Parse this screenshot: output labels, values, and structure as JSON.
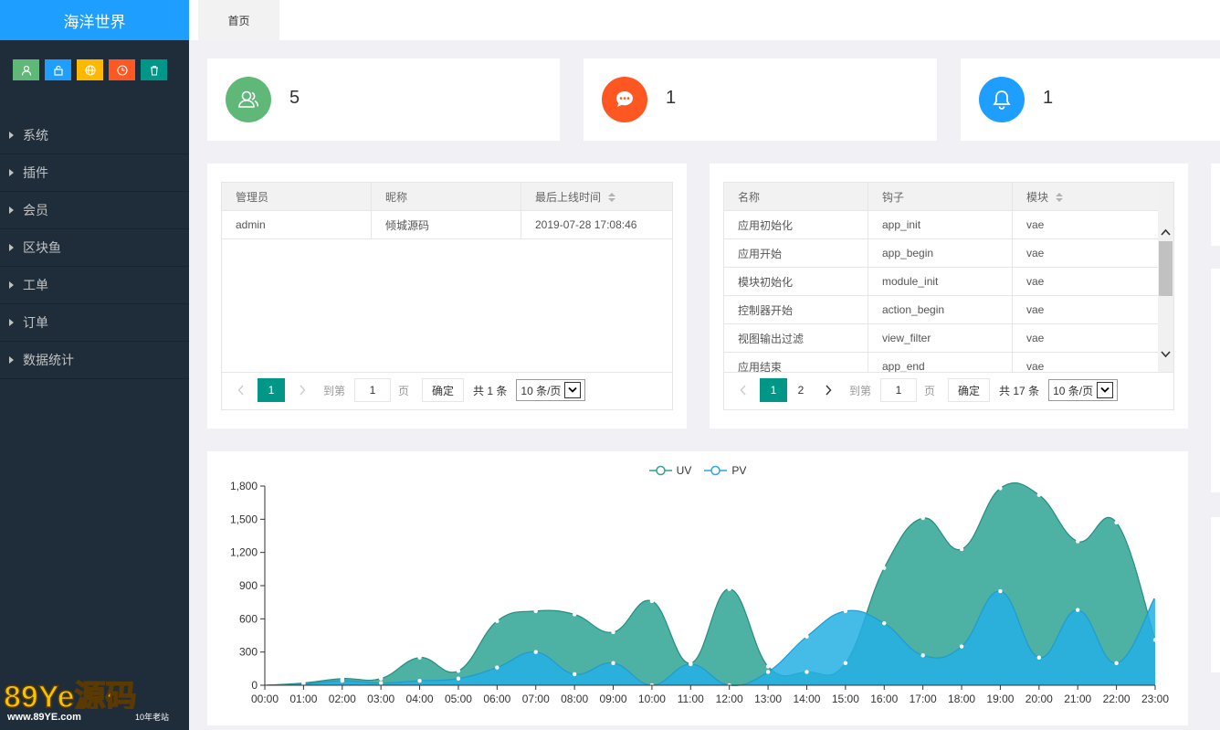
{
  "app": {
    "title": "海洋世界"
  },
  "quick_buttons": [
    {
      "icon": "user-icon",
      "color": "#5fb878"
    },
    {
      "icon": "lock-icon",
      "color": "#1e9fff"
    },
    {
      "icon": "globe-icon",
      "color": "#ffb800"
    },
    {
      "icon": "clock-icon",
      "color": "#ff5722"
    },
    {
      "icon": "trash-icon",
      "color": "#009688"
    }
  ],
  "sidebar": {
    "items": [
      {
        "label": "系统"
      },
      {
        "label": "插件"
      },
      {
        "label": "会员"
      },
      {
        "label": "区块鱼"
      },
      {
        "label": "工单"
      },
      {
        "label": "订单"
      },
      {
        "label": "数据统计"
      }
    ]
  },
  "tabs": [
    {
      "label": "首页"
    }
  ],
  "stats": [
    {
      "value": "5",
      "icon": "users-icon",
      "color": "#5fb878"
    },
    {
      "value": "1",
      "icon": "message-icon",
      "color": "#ff5722"
    },
    {
      "value": "1",
      "icon": "bell-icon",
      "color": "#1e9fff"
    }
  ],
  "admins_table": {
    "headers": [
      "管理员",
      "昵称",
      "最后上线时间"
    ],
    "rows": [
      [
        "admin",
        "倾城源码",
        "2019-07-28 17:08:46"
      ]
    ],
    "pager": {
      "current": "1",
      "goto_label": "到第",
      "page_input": "1",
      "page_unit": "页",
      "confirm": "确定",
      "total": "共 1 条",
      "per_page": "10 条/页"
    }
  },
  "hooks_table": {
    "headers": [
      "名称",
      "钩子",
      "模块"
    ],
    "rows": [
      [
        "应用初始化",
        "app_init",
        "vae"
      ],
      [
        "应用开始",
        "app_begin",
        "vae"
      ],
      [
        "模块初始化",
        "module_init",
        "vae"
      ],
      [
        "控制器开始",
        "action_begin",
        "vae"
      ],
      [
        "视图输出过滤",
        "view_filter",
        "vae"
      ],
      [
        "应用结束",
        "app_end",
        "vae"
      ]
    ],
    "pager": {
      "current": "1",
      "page2": "2",
      "goto_label": "到第",
      "page_input": "1",
      "page_unit": "页",
      "confirm": "确定",
      "total": "共 17 条",
      "per_page": "10 条/页"
    }
  },
  "watermark": {
    "brand": "89Ye源码",
    "site": "www.89YE.com",
    "tag": "10年老站"
  },
  "chart_data": {
    "type": "area",
    "x": [
      "00:00",
      "01:00",
      "02:00",
      "03:00",
      "04:00",
      "05:00",
      "06:00",
      "07:00",
      "08:00",
      "09:00",
      "10:00",
      "11:00",
      "12:00",
      "13:00",
      "14:00",
      "15:00",
      "16:00",
      "17:00",
      "18:00",
      "19:00",
      "20:00",
      "21:00",
      "22:00",
      "23:00"
    ],
    "series": [
      {
        "name": "UV",
        "color": "#2ec7c9",
        "fill": "#3aa89a",
        "values": [
          0,
          20,
          60,
          60,
          250,
          130,
          580,
          670,
          640,
          480,
          760,
          200,
          870,
          170,
          120,
          200,
          1060,
          1510,
          1230,
          1780,
          1720,
          1300,
          1470,
          410
        ]
      },
      {
        "name": "PV",
        "color": "#5ab1ef",
        "fill": "#24b0e4",
        "values": [
          0,
          10,
          40,
          20,
          40,
          60,
          160,
          300,
          100,
          200,
          0,
          190,
          0,
          120,
          440,
          670,
          560,
          270,
          350,
          850,
          250,
          680,
          200,
          800
        ]
      }
    ],
    "ylim": [
      0,
      1800
    ],
    "yticks": [
      "0",
      "300",
      "600",
      "900",
      "1,200",
      "1,500",
      "1,800"
    ],
    "legend": "top-center",
    "grid": false
  }
}
